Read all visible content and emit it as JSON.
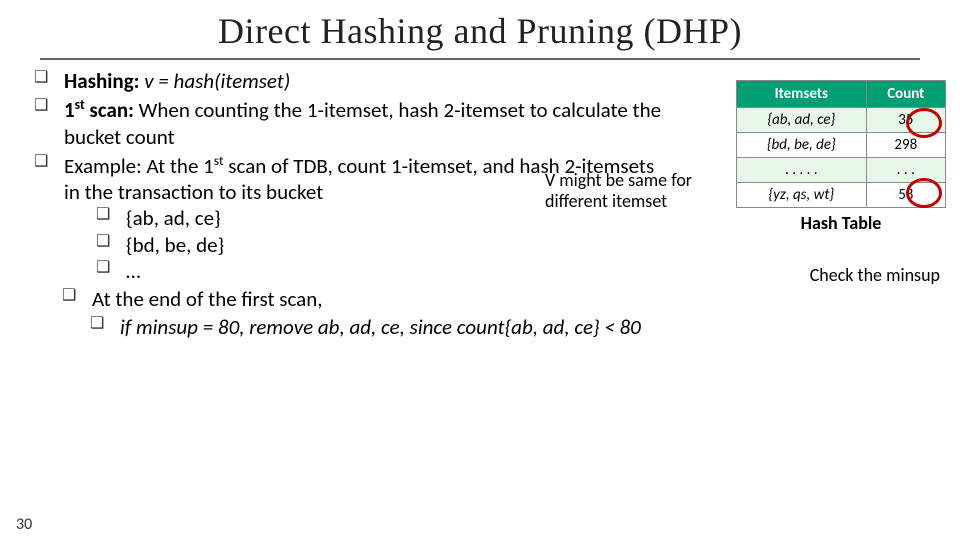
{
  "title": "Direct Hashing and Pruning (DHP)",
  "bullets": {
    "b1_label": "Hashing:",
    "b1_rest": "  v = hash(itemset)",
    "b2_label": "1",
    "b2_sup": "st",
    "b2_label2": " scan:",
    "b2_rest": " When counting the 1-itemset, hash 2-itemset to calculate the bucket count",
    "b3a": "Example: At the 1",
    "b3sup": "st",
    "b3b": " scan of TDB, count 1-itemset, and hash 2-itemsets in the transaction to its bucket",
    "s1": "{ab, ad, ce}",
    "s2": "{bd, be, de}",
    "s3": "…",
    "b4": "At the end of the first scan,",
    "s4": "if minsup = 80, remove ab, ad, ce, since count{ab, ad, ce} < 80"
  },
  "annotation": "V might be same for different itemset",
  "table": {
    "h1": "Itemsets",
    "h2": "Count",
    "rows": [
      {
        "itemset": "{ab, ad, ce}",
        "count": "35"
      },
      {
        "itemset": "{bd, be, de}",
        "count": "298"
      },
      {
        "itemset": ". . . . .",
        "count": ". . ."
      },
      {
        "itemset": "{yz, qs, wt}",
        "count": "58"
      }
    ],
    "caption": "Hash Table"
  },
  "check_label": "Check the minsup",
  "page": "30"
}
